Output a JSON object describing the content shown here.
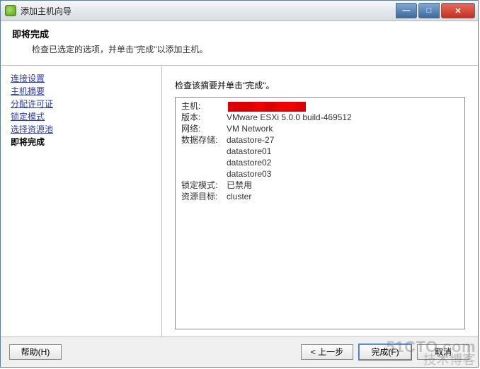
{
  "window": {
    "title": "添加主机向导"
  },
  "header": {
    "title": "即将完成",
    "desc": "检查已选定的选项，并单击\"完成\"以添加主机。"
  },
  "nav": {
    "items": [
      {
        "label": "连接设置"
      },
      {
        "label": "主机摘要"
      },
      {
        "label": "分配许可证"
      },
      {
        "label": "锁定模式"
      },
      {
        "label": "选择资源池"
      }
    ],
    "current": "即将完成"
  },
  "content": {
    "instruction": "检查该摘要并单击\"完成\"。",
    "labels": {
      "host": "主机:",
      "version": "版本:",
      "network": "网络:",
      "datastores": "数据存储:",
      "lockdown": "锁定模式:",
      "resource_target": "资源目标:"
    },
    "values": {
      "host_redacted": true,
      "version": "VMware ESXi 5.0.0 build-469512",
      "network": "VM Network",
      "datastores": [
        "datastore-27",
        "datastore01",
        "datastore02",
        "datastore03"
      ],
      "lockdown": "已禁用",
      "resource_target": "cluster"
    }
  },
  "footer": {
    "help": "帮助(H)",
    "back": "< 上一步",
    "finish": "完成(F)",
    "cancel": "取消"
  },
  "watermark": {
    "line1": "51CTO.com",
    "line2": "技术博客"
  }
}
